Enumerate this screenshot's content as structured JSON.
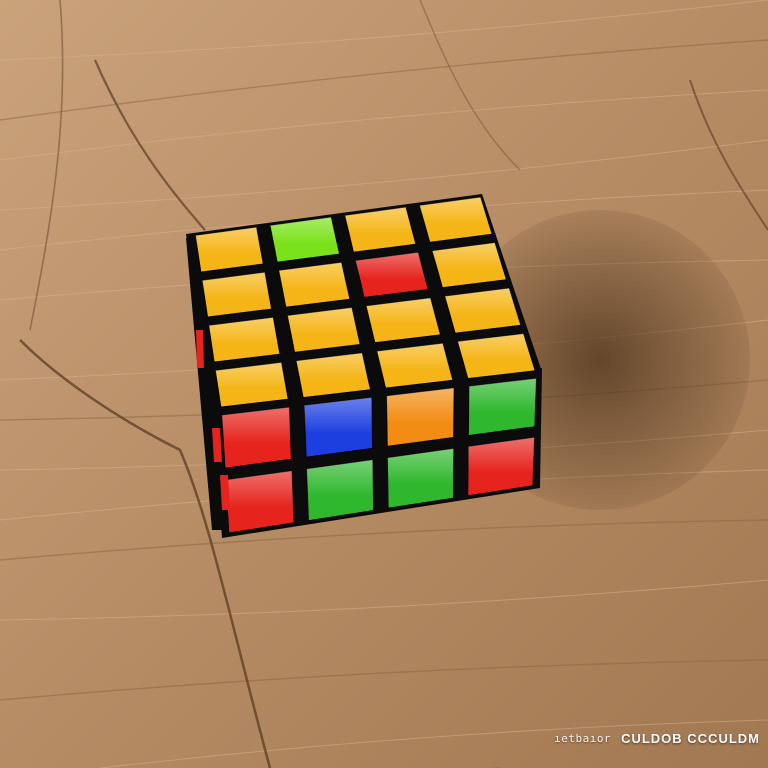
{
  "scene": {
    "subject": "4x4 puzzle cube on wooden surface",
    "background": "light oak wood planks",
    "colors": {
      "wood_light": "#c49a72",
      "wood_mid": "#a87f5b",
      "wood_dark": "#7a5638",
      "shadow": "#5a3c24",
      "cube_body": "#0b0b0b",
      "yellow": "#f5b516",
      "green": "#2fb82e",
      "lime": "#7ae21a",
      "red": "#e6231c",
      "blue": "#1d3fe0",
      "orange": "#f28c12"
    }
  },
  "cube": {
    "top_face": [
      [
        "yellow",
        "lime",
        "yellow",
        "yellow"
      ],
      [
        "yellow",
        "yellow",
        "red",
        "yellow"
      ],
      [
        "yellow",
        "yellow",
        "yellow",
        "yellow"
      ],
      [
        "yellow",
        "yellow",
        "yellow",
        "yellow"
      ]
    ],
    "front_face": [
      [
        "red",
        "blue",
        "orange",
        "green"
      ],
      [
        "red",
        "green",
        "green",
        "red"
      ]
    ]
  },
  "watermark": {
    "left_text": "ıetbaıor",
    "right_text": "CULDOB CCCULDM"
  }
}
